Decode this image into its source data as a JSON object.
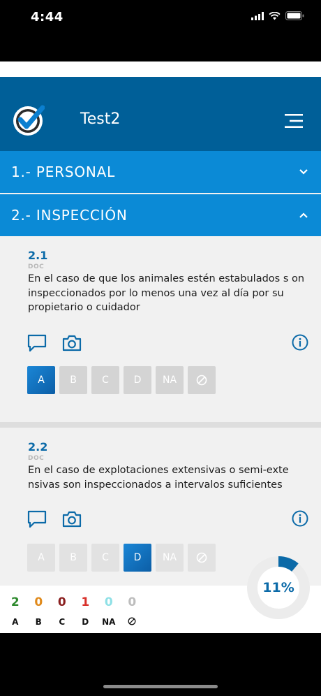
{
  "status": {
    "time": "4:44"
  },
  "header": {
    "title": "Test2"
  },
  "sections": [
    {
      "label": "1.- PERSONAL"
    },
    {
      "label": "2.- INSPECCIÓN"
    }
  ],
  "questions": [
    {
      "number": "2.1",
      "tag": "DOC",
      "text": "En el caso de que los animales estén estabulados s on inspeccionados por lo menos una vez al día por su propietario o cuidador",
      "selected": "A"
    },
    {
      "number": "2.2",
      "tag": "DOC",
      "text": "En el caso de explotaciones extensivas o semi-exte nsivas son inspeccionados a intervalos suficientes",
      "selected": "D"
    }
  ],
  "options": [
    "A",
    "B",
    "C",
    "D",
    "NA"
  ],
  "summary": {
    "counts": [
      {
        "label": "A",
        "value": "2",
        "color": "#2e8a2e"
      },
      {
        "label": "B",
        "value": "0",
        "color": "#e08a1c"
      },
      {
        "label": "C",
        "value": "0",
        "color": "#8a1f1f"
      },
      {
        "label": "D",
        "value": "1",
        "color": "#d8312b"
      },
      {
        "label": "NA",
        "value": "0",
        "color": "#8ee0e6"
      },
      {
        "label": "",
        "value": "0",
        "color": "#bdbdbd"
      }
    ]
  },
  "progress": {
    "label": "11%",
    "fraction": 0.11
  },
  "colors": {
    "header": "#005f98",
    "section": "#0b8ad6",
    "accent": "#0b6aa8"
  }
}
